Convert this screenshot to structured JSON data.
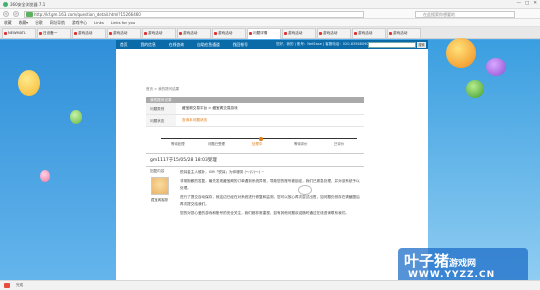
{
  "window": {
    "title": "360安全浏览器 7.1",
    "controls": [
      "—",
      "□",
      "✕"
    ]
  },
  "address": {
    "url": "http://kf.gm.163.com/question_detail.html?15266460",
    "search_placeholder": "在此搜索你想要的"
  },
  "bookmarks": [
    "收藏",
    "收藏▾",
    "谷歌",
    "网址导航",
    "游戏中心",
    "Links",
    "Links for you"
  ],
  "tabs": [
    "NEWMATL",
    "日设备一",
    "游戏活动",
    "游戏活动",
    "游戏活动",
    "游戏活动",
    "游戏活动",
    "问题详情",
    "游戏活动",
    "游戏活动",
    "游戏活动",
    "游戏活动"
  ],
  "site": {
    "nav": [
      "首页",
      "我的信息",
      "在线咨询",
      "自助应急通道",
      "找回帐号"
    ],
    "user_info": "您好，我的 | 账号：NetEase | 客服电话：020-83568090",
    "search_button": "搜索"
  },
  "breadcrumb": "首页 > 我的提问结果",
  "section_title": "我的提问记录",
  "detail": {
    "product_label": "问题类别",
    "product_value": "藏宝阁交易平台 > 藏宝阁交易游戏",
    "status_label": "问题状态",
    "status_value": "查询本问题状态"
  },
  "steps": [
    "等待处理",
    "问题已受理",
    "处理中",
    "等待评价",
    "已评价"
  ],
  "question": "gm1117于15/05/28 18:03受理",
  "answer_label": "回复内容",
  "answerer": "藏宝阁客服",
  "answer_paragraphs": [
    "悦耳金主人候补，GM「悦耳」为你服务 (～)▽(～) ~",
    "非常抱歉的答复，最先发现藏宝阁的订单遇到系统异常，导致您的账号被锁定，我们已紧急处理，并对该系统予以处理。",
    "进行了提交自动保存，就这边已经在对系统进行修复和监测，您可以放心再次尝试出售，如问题仍然存在请截图后再次提交给我们。",
    "您的对您心爱的游戏和账号的安全关注，我们都非常重视，如有其他问题欢迎随时通过在线咨询联系我们。"
  ],
  "watermark": {
    "line1": "叶子猪",
    "line1_suffix": "游戏网",
    "line2": "WWW.YYZZ.CN"
  },
  "status_text": "完成"
}
